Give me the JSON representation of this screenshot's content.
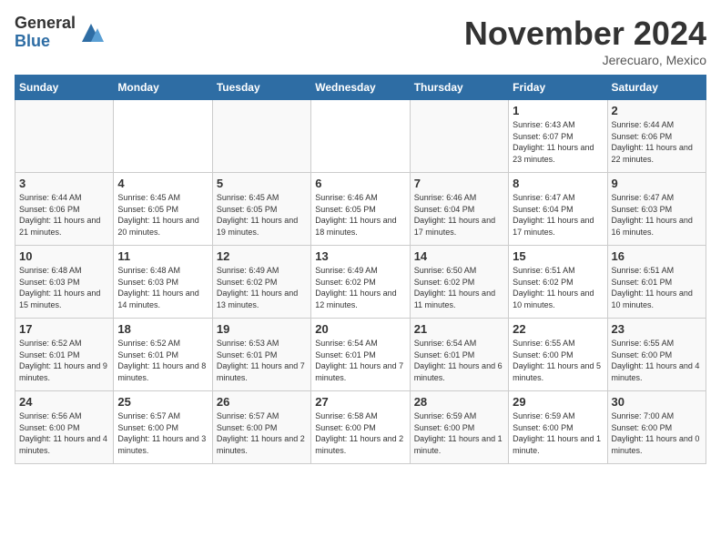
{
  "logo": {
    "general": "General",
    "blue": "Blue"
  },
  "title": "November 2024",
  "subtitle": "Jerecuaro, Mexico",
  "days_of_week": [
    "Sunday",
    "Monday",
    "Tuesday",
    "Wednesday",
    "Thursday",
    "Friday",
    "Saturday"
  ],
  "weeks": [
    [
      {
        "day": "",
        "info": ""
      },
      {
        "day": "",
        "info": ""
      },
      {
        "day": "",
        "info": ""
      },
      {
        "day": "",
        "info": ""
      },
      {
        "day": "",
        "info": ""
      },
      {
        "day": "1",
        "info": "Sunrise: 6:43 AM\nSunset: 6:07 PM\nDaylight: 11 hours and 23 minutes."
      },
      {
        "day": "2",
        "info": "Sunrise: 6:44 AM\nSunset: 6:06 PM\nDaylight: 11 hours and 22 minutes."
      }
    ],
    [
      {
        "day": "3",
        "info": "Sunrise: 6:44 AM\nSunset: 6:06 PM\nDaylight: 11 hours and 21 minutes."
      },
      {
        "day": "4",
        "info": "Sunrise: 6:45 AM\nSunset: 6:05 PM\nDaylight: 11 hours and 20 minutes."
      },
      {
        "day": "5",
        "info": "Sunrise: 6:45 AM\nSunset: 6:05 PM\nDaylight: 11 hours and 19 minutes."
      },
      {
        "day": "6",
        "info": "Sunrise: 6:46 AM\nSunset: 6:05 PM\nDaylight: 11 hours and 18 minutes."
      },
      {
        "day": "7",
        "info": "Sunrise: 6:46 AM\nSunset: 6:04 PM\nDaylight: 11 hours and 17 minutes."
      },
      {
        "day": "8",
        "info": "Sunrise: 6:47 AM\nSunset: 6:04 PM\nDaylight: 11 hours and 17 minutes."
      },
      {
        "day": "9",
        "info": "Sunrise: 6:47 AM\nSunset: 6:03 PM\nDaylight: 11 hours and 16 minutes."
      }
    ],
    [
      {
        "day": "10",
        "info": "Sunrise: 6:48 AM\nSunset: 6:03 PM\nDaylight: 11 hours and 15 minutes."
      },
      {
        "day": "11",
        "info": "Sunrise: 6:48 AM\nSunset: 6:03 PM\nDaylight: 11 hours and 14 minutes."
      },
      {
        "day": "12",
        "info": "Sunrise: 6:49 AM\nSunset: 6:02 PM\nDaylight: 11 hours and 13 minutes."
      },
      {
        "day": "13",
        "info": "Sunrise: 6:49 AM\nSunset: 6:02 PM\nDaylight: 11 hours and 12 minutes."
      },
      {
        "day": "14",
        "info": "Sunrise: 6:50 AM\nSunset: 6:02 PM\nDaylight: 11 hours and 11 minutes."
      },
      {
        "day": "15",
        "info": "Sunrise: 6:51 AM\nSunset: 6:02 PM\nDaylight: 11 hours and 10 minutes."
      },
      {
        "day": "16",
        "info": "Sunrise: 6:51 AM\nSunset: 6:01 PM\nDaylight: 11 hours and 10 minutes."
      }
    ],
    [
      {
        "day": "17",
        "info": "Sunrise: 6:52 AM\nSunset: 6:01 PM\nDaylight: 11 hours and 9 minutes."
      },
      {
        "day": "18",
        "info": "Sunrise: 6:52 AM\nSunset: 6:01 PM\nDaylight: 11 hours and 8 minutes."
      },
      {
        "day": "19",
        "info": "Sunrise: 6:53 AM\nSunset: 6:01 PM\nDaylight: 11 hours and 7 minutes."
      },
      {
        "day": "20",
        "info": "Sunrise: 6:54 AM\nSunset: 6:01 PM\nDaylight: 11 hours and 7 minutes."
      },
      {
        "day": "21",
        "info": "Sunrise: 6:54 AM\nSunset: 6:01 PM\nDaylight: 11 hours and 6 minutes."
      },
      {
        "day": "22",
        "info": "Sunrise: 6:55 AM\nSunset: 6:00 PM\nDaylight: 11 hours and 5 minutes."
      },
      {
        "day": "23",
        "info": "Sunrise: 6:55 AM\nSunset: 6:00 PM\nDaylight: 11 hours and 4 minutes."
      }
    ],
    [
      {
        "day": "24",
        "info": "Sunrise: 6:56 AM\nSunset: 6:00 PM\nDaylight: 11 hours and 4 minutes."
      },
      {
        "day": "25",
        "info": "Sunrise: 6:57 AM\nSunset: 6:00 PM\nDaylight: 11 hours and 3 minutes."
      },
      {
        "day": "26",
        "info": "Sunrise: 6:57 AM\nSunset: 6:00 PM\nDaylight: 11 hours and 2 minutes."
      },
      {
        "day": "27",
        "info": "Sunrise: 6:58 AM\nSunset: 6:00 PM\nDaylight: 11 hours and 2 minutes."
      },
      {
        "day": "28",
        "info": "Sunrise: 6:59 AM\nSunset: 6:00 PM\nDaylight: 11 hours and 1 minute."
      },
      {
        "day": "29",
        "info": "Sunrise: 6:59 AM\nSunset: 6:00 PM\nDaylight: 11 hours and 1 minute."
      },
      {
        "day": "30",
        "info": "Sunrise: 7:00 AM\nSunset: 6:00 PM\nDaylight: 11 hours and 0 minutes."
      }
    ]
  ]
}
